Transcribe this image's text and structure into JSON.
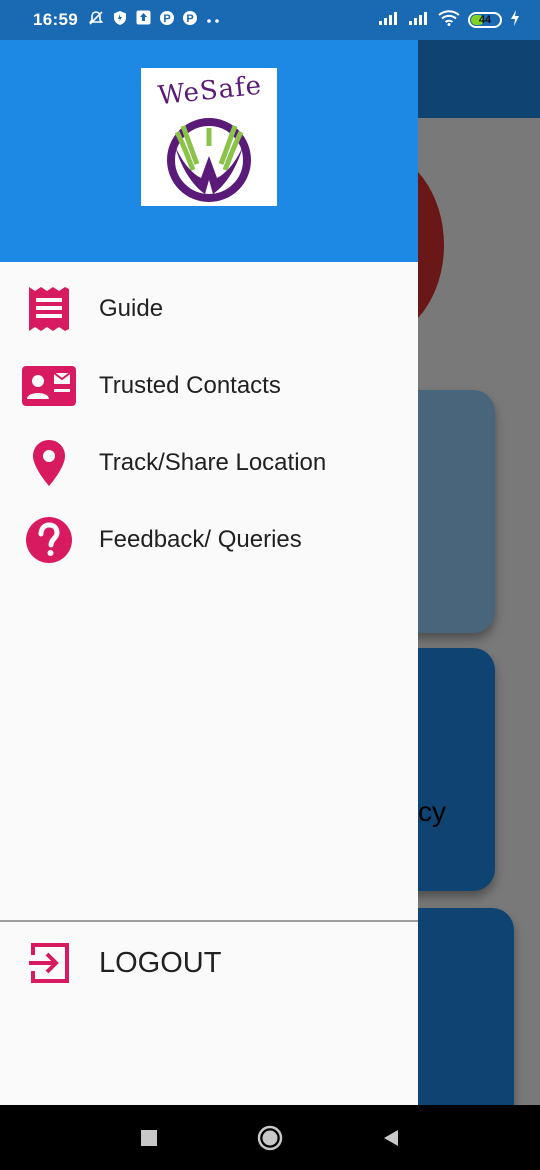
{
  "status_bar": {
    "time": "16:59",
    "battery": "44",
    "battery_fraction": 0.44,
    "icons": [
      "alarm-off-icon",
      "shield-icon",
      "upload-icon",
      "p-icon",
      "p-icon",
      "more-dots-icon",
      "signal-icon",
      "signal-icon",
      "wifi-icon",
      "battery-icon",
      "charging-icon"
    ]
  },
  "app": {
    "logo_text": "WeSafe",
    "background_card_text": "cy"
  },
  "drawer": {
    "menu": [
      {
        "label": "Guide",
        "icon": "receipt-icon"
      },
      {
        "label": "Trusted Contacts",
        "icon": "contact-card-icon"
      },
      {
        "label": "Track/Share Location",
        "icon": "location-pin-icon"
      },
      {
        "label": "Feedback/ Queries",
        "icon": "help-icon"
      }
    ],
    "logout_label": "LOGOUT"
  },
  "colors": {
    "accent": "#d81b60",
    "header": "#1e88e5",
    "status_bar": "#1a6ab3",
    "logo_purple": "#5a1a78",
    "logo_green": "#8bc34a"
  },
  "nav_bar": {
    "buttons": [
      "recents-square-icon",
      "home-circle-icon",
      "back-triangle-icon"
    ]
  }
}
